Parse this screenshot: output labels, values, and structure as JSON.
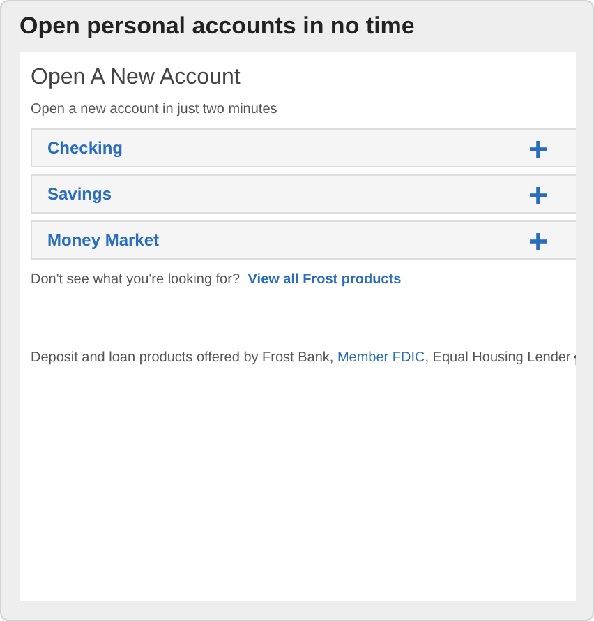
{
  "title": "Open personal accounts in no time",
  "panel": {
    "heading": "Open A New Account",
    "subheading": "Open a new account in just two minutes",
    "accounts": [
      {
        "label": "Checking",
        "expanded": false
      },
      {
        "label": "Savings",
        "expanded": false
      },
      {
        "label": "Money Market",
        "expanded": false
      }
    ],
    "prompt": "Don't see what you're looking for?",
    "prompt_link": "View all Frost products",
    "disclaimer": {
      "before": "Deposit and loan products offered by Frost Bank, ",
      "link": "Member FDIC",
      "after": ", Equal Housing Lender"
    }
  }
}
